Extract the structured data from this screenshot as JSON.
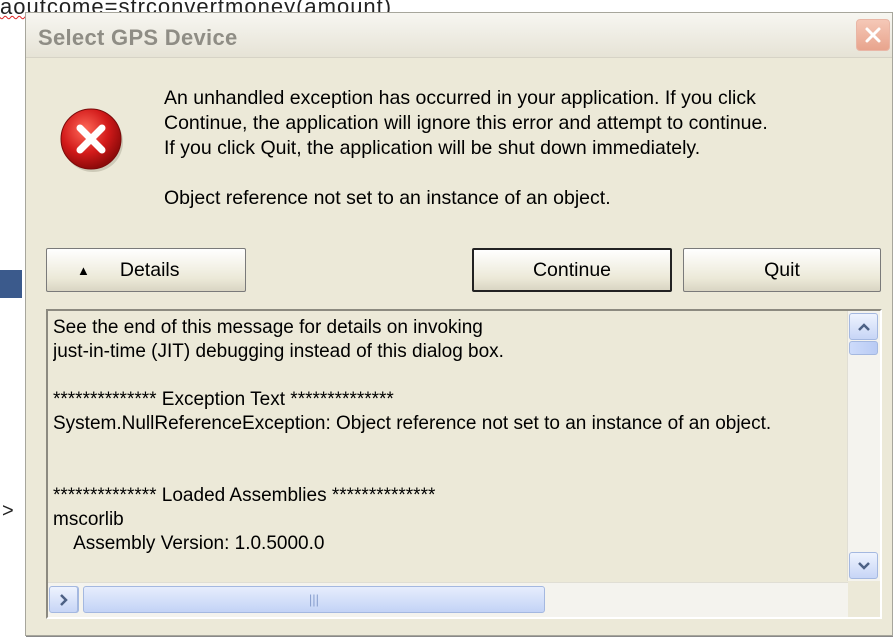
{
  "background": {
    "top_text": "aoutcome=strconvertmoney(amount)",
    "side_glyph": ">"
  },
  "dialog": {
    "title": "Select GPS Device",
    "message_lines": [
      "An unhandled exception has occurred in your application. If you click",
      "Continue, the application will ignore this error and attempt to continue.",
      "If you click Quit, the application will be shut down immediately."
    ],
    "exception_message": "Object reference not set to an instance of an object.",
    "buttons": {
      "details": "Details",
      "continue": "Continue",
      "quit": "Quit"
    },
    "details_lines": [
      "See the end of this message for details on invoking",
      "just-in-time (JIT) debugging instead of this dialog box.",
      "",
      "************** Exception Text **************",
      "System.NullReferenceException: Object reference not set to an instance of an object.",
      "",
      "",
      "************** Loaded Assemblies **************",
      "mscorlib",
      "    Assembly Version: 1.0.5000.0"
    ],
    "icons": {
      "error": "error-icon",
      "close": "close-icon",
      "details_toggle": "triangle-up-icon"
    },
    "colors": {
      "error_red": "#d21a1a",
      "close_bg": "#e8a48d",
      "dialog_bg": "#ece9d8"
    }
  }
}
